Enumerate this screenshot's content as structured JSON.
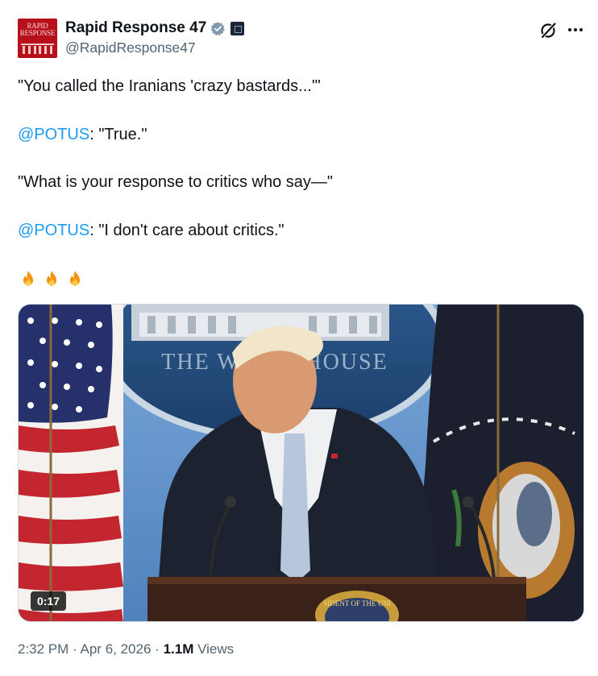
{
  "account": {
    "display_name": "Rapid Response 47",
    "handle": "@RapidResponse47",
    "avatar_text_line1": "RAPID",
    "avatar_text_line2": "RESPONSE"
  },
  "tweet": {
    "line1": "\"You called the Iranians 'crazy bastards...'\"",
    "line2_mention": "@POTUS",
    "line2_text": ": \"True.\"",
    "line3": "\"What is your response to critics who say—\"",
    "line4_mention": "@POTUS",
    "line4_text": ": \"I don't care about critics.\"",
    "emoji": [
      "fire-emoji",
      "fire-emoji",
      "fire-emoji"
    ]
  },
  "media": {
    "duration": "0:17",
    "seal_text": "THE WHITE HOUSE",
    "podium_text": "SIDENT OF THE UNI"
  },
  "meta": {
    "time": "2:32 PM",
    "separator": "·",
    "date": "Apr 6, 2026",
    "views_count": "1.1M",
    "views_label": "Views"
  },
  "colors": {
    "mention": "#1d9bf0",
    "verified": "#829aab",
    "secondary_text": "#536471",
    "primary_text": "#0f1419"
  }
}
